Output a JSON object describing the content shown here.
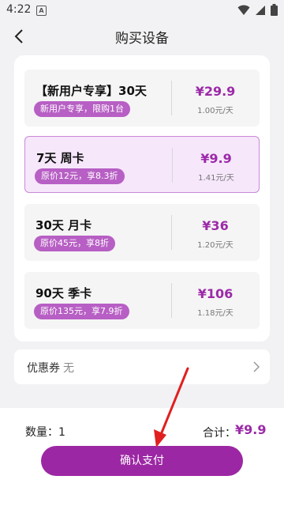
{
  "status_bar": {
    "time": "4:22",
    "notif_glyph": "A"
  },
  "header": {
    "title": "购买设备"
  },
  "plans": [
    {
      "name": "【新用户专享】30天",
      "tag": "新用户专享，限购1台",
      "price": "¥29.9",
      "daily": "1.00元/天",
      "selected": false
    },
    {
      "name": "7天 周卡",
      "tag": "原价12元，享8.3折",
      "price": "¥9.9",
      "daily": "1.41元/天",
      "selected": true
    },
    {
      "name": "30天 月卡",
      "tag": "原价45元，享8折",
      "price": "¥36",
      "daily": "1.20元/天",
      "selected": false
    },
    {
      "name": "90天 季卡",
      "tag": "原价135元，享7.9折",
      "price": "¥106",
      "daily": "1.18元/天",
      "selected": false
    }
  ],
  "coupon": {
    "label": "优惠券",
    "value": "无"
  },
  "footer": {
    "quantity": "数量：1",
    "total_label": "合计：",
    "total_value": "¥9.9",
    "pay_label": "确认支付"
  },
  "colors": {
    "accent": "#9c27a4",
    "tag_bg": "#b75fc4",
    "price": "#9c2aa8",
    "arrow": "#e02020"
  },
  "icons": [
    "back-arrow-icon",
    "wifi-icon",
    "signal-icon",
    "battery-icon",
    "chevron-right-icon"
  ]
}
